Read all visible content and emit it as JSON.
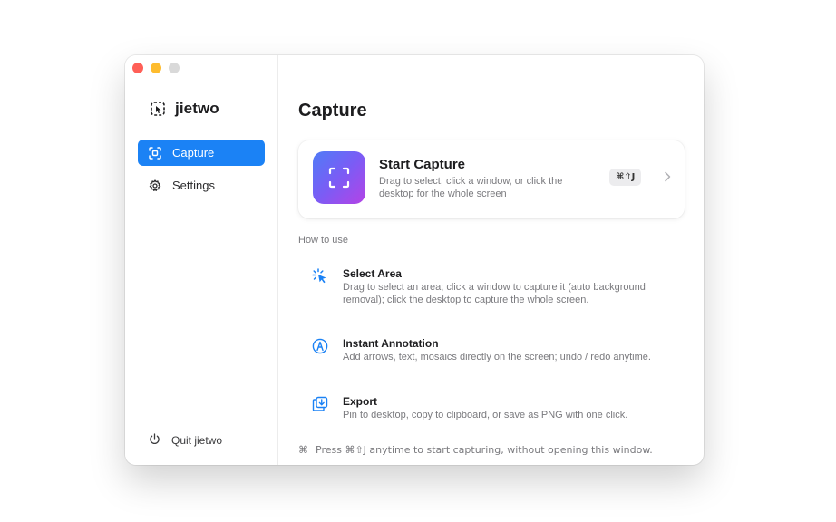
{
  "app": {
    "name": "jietwo",
    "accent": "#1b82f5"
  },
  "sidebar": {
    "items": [
      {
        "label": "Capture",
        "icon": "capture-icon",
        "active": true
      },
      {
        "label": "Settings",
        "icon": "gear-icon",
        "active": false
      }
    ],
    "quit_label": "Quit jietwo"
  },
  "main": {
    "title": "Capture",
    "capture_card": {
      "title": "Start Capture",
      "description": "Drag to select, click a window, or click the desktop for the whole screen",
      "shortcut": "⌘⇧J",
      "icon": "scan-frame-icon"
    },
    "how_to_use_label": "How to use",
    "features": [
      {
        "title": "Select Area",
        "description": "Drag to select an area; click a window to capture it (auto background removal); click the desktop to capture the whole screen.",
        "icon": "cursor-click-icon"
      },
      {
        "title": "Instant Annotation",
        "description": "Add arrows, text, mosaics directly on the screen; undo / redo anytime.",
        "icon": "pen-circle-icon"
      },
      {
        "title": "Export",
        "description": "Pin to desktop, copy to clipboard, or save as PNG with one click.",
        "icon": "download-tray-icon"
      }
    ],
    "footer_tip": "Press ⌘⇧J anytime to start capturing, without opening this window."
  }
}
